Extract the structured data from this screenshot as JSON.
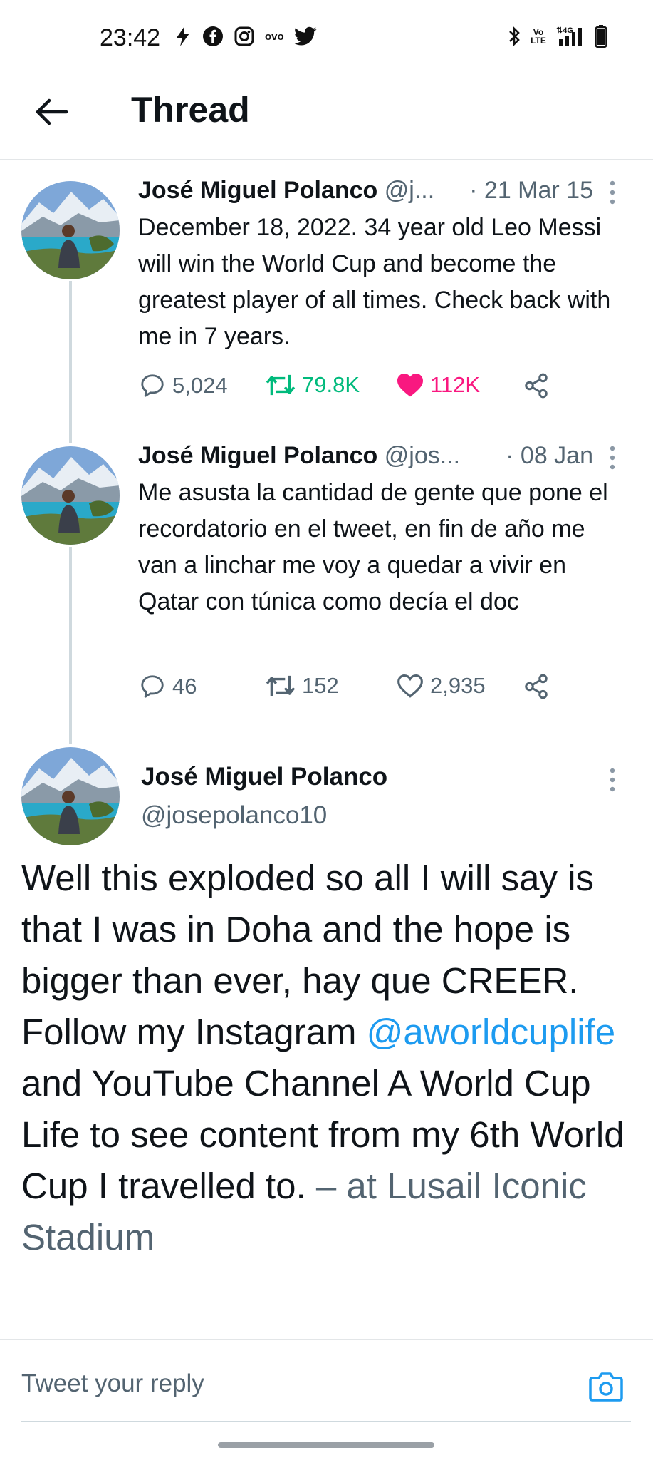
{
  "status_bar": {
    "time": "23:42",
    "left_icons": [
      "signal-app-icon",
      "facebook-icon",
      "instagram-icon",
      "ovo-icon",
      "twitter-icon"
    ],
    "ovo_label": "ovo",
    "right_icons": [
      "bluetooth-icon",
      "volte-icon",
      "network-4g-icon",
      "battery-icon"
    ],
    "volte_label": "Vo LTE",
    "network_label": "4G"
  },
  "header": {
    "title": "Thread"
  },
  "tweets": [
    {
      "name": "José Miguel Polanco",
      "handle": "@j...",
      "date": "· 21 Mar 15",
      "text": "December 18, 2022. 34 year old Leo Messi will win the World Cup and become the greatest player of all times. Check back with me in 7 years.",
      "replies": "5,024",
      "retweets": "79.8K",
      "likes": "112K",
      "retweeted": true,
      "liked": true
    },
    {
      "name": "José Miguel Polanco",
      "handle": "@jos...",
      "date": "· 08 Jan",
      "text": "Me asusta la cantidad de gente que pone el recordatorio en el tweet, en fin de año me van a linchar me voy a quedar a vivir en Qatar con túnica como decía el doc",
      "replies": "46",
      "retweets": "152",
      "likes": "2,935",
      "retweeted": false,
      "liked": false
    }
  ],
  "main_tweet": {
    "name": "José Miguel Polanco",
    "handle": "@josepolanco10",
    "text_part1": "Well this exploded so all I will say is that I was in Doha and the hope is bigger than ever, hay que CREER. Follow my Instagram ",
    "mention": "@aworldcuplife",
    "text_part2": " and YouTube Channel A World Cup Life to see content from my 6th World Cup I travelled to. ",
    "location": "– at Lusail Iconic Stadium"
  },
  "reply": {
    "placeholder": "Tweet your reply"
  },
  "colors": {
    "accent": "#1d9bf0",
    "retweet_active": "#00ba7c",
    "like_active": "#f91880",
    "secondary_text": "#536471"
  }
}
